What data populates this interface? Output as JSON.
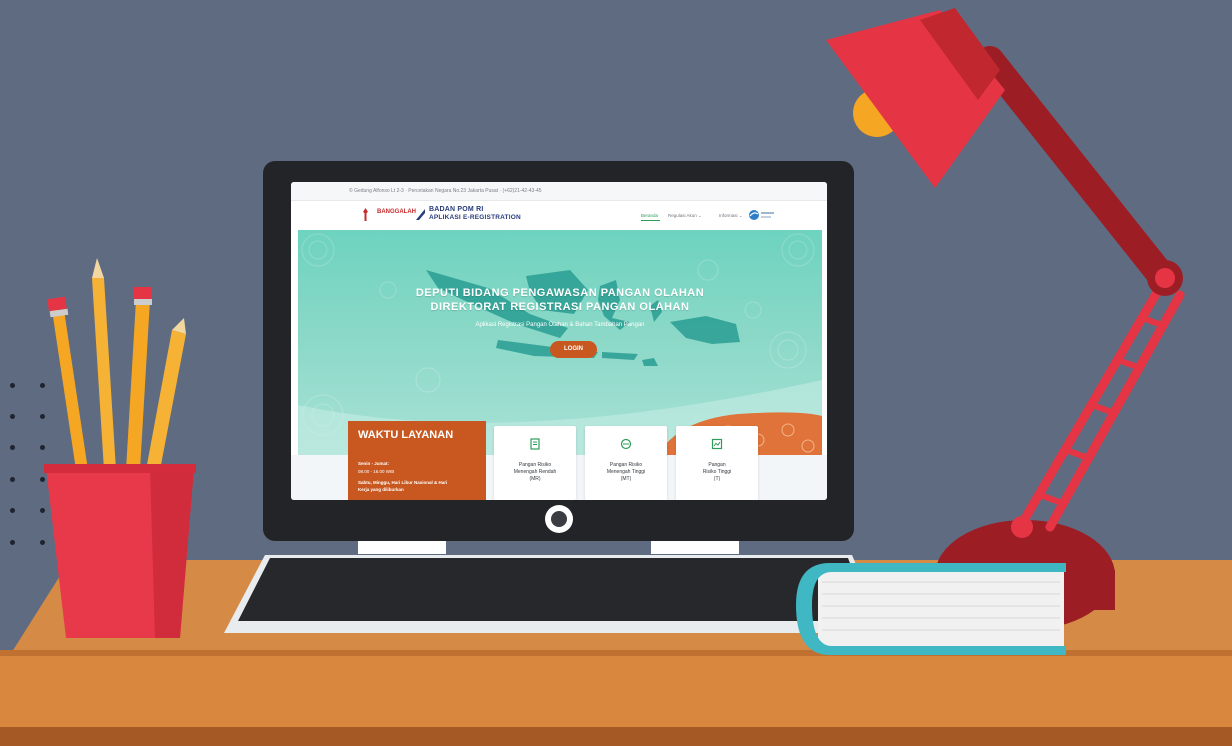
{
  "colors": {
    "wall": "#5f6b80",
    "desk_top": "#d9873f",
    "desk_front": "#c87433",
    "hero_teal": "#6dd3bf",
    "accent_orange": "#c8581f",
    "lamp_red": "#e53545",
    "cup_red": "#e8394a",
    "book_teal": "#3fb8c3",
    "nav_active_green": "#2e9d5a"
  },
  "icons": {
    "logo_emblem": "torch-emblem-icon",
    "logo_bpom": "bird-wing-icon",
    "nav_brand": "circular-swoosh-icon",
    "card1": "document-icon",
    "card2": "ticket-icon",
    "card3": "chart-icon"
  },
  "browser": {
    "topbar_text": "© Gedung Alfonso Lt 2-3  · Percetakan Negara No.23 Jakarta Pusat  · (+62)21-42-43-45"
  },
  "header": {
    "logo_text": "BANGGALAH",
    "org_line1": "BADAN POM RI",
    "org_line2": "APLIKASI E-REGISTRATION",
    "nav": {
      "beranda": "Beranda",
      "regulasi": "Regulasi Akun ⌄",
      "informasi": "Informasi ⌄"
    }
  },
  "hero": {
    "title_line1": "DEPUTI BIDANG PENGAWASAN PANGAN OLAHAN",
    "title_line2": "DIREKTORAT REGISTRASI PANGAN OLAHAN",
    "subtitle": "Aplikasi Registrasi Pangan Olahan & Bahan Tambahan Pangan",
    "login_label": "LOGIN"
  },
  "waktu_layanan": {
    "title": "WAKTU LAYANAN",
    "line1": "Senin - Jumat:",
    "line2": "08.00 - 16.00 WIB",
    "line3": "Sabtu, Minggu, Hari Libur Nasional & Hari",
    "line4": "Kerja yang diliburkan"
  },
  "cards": [
    {
      "line1": "Pangan Risiko",
      "line2": "Menengah Rendah",
      "line3": "(MR)"
    },
    {
      "line1": "Pangan Risiko",
      "line2": "Menengah Tinggi",
      "line3": "(MT)"
    },
    {
      "line1": "Pangan",
      "line2": "Risiko Tinggi",
      "line3": "(T)"
    }
  ]
}
